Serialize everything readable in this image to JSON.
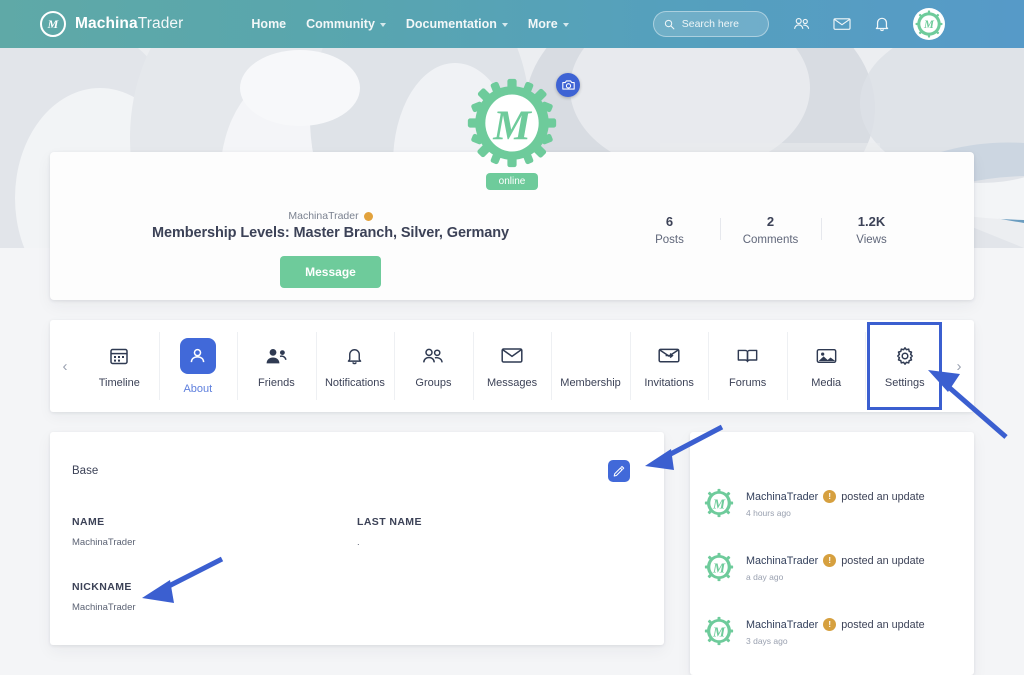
{
  "header": {
    "brand_bold": "Machina",
    "brand_light": "Trader",
    "brand_logo_letter": "M",
    "nav": [
      {
        "label": "Home",
        "has_caret": false
      },
      {
        "label": "Community",
        "has_caret": true
      },
      {
        "label": "Documentation",
        "has_caret": true
      },
      {
        "label": "More",
        "has_caret": true
      }
    ],
    "search": {
      "placeholder": "Search here"
    },
    "icons": [
      "friends-icon",
      "messages-icon",
      "notifications-icon",
      "account-avatar"
    ],
    "colors": {
      "gradient_left": "#5fa9a7",
      "gradient_right": "#569ac8"
    }
  },
  "profile": {
    "avatar_letter": "M",
    "camera_button": "camera-icon",
    "online_label": "online",
    "username": "MachinaTrader",
    "membership": "Membership Levels: Master Branch, Silver, Germany",
    "message_button": "Message",
    "stats": [
      {
        "value": "6",
        "label": "Posts"
      },
      {
        "value": "2",
        "label": "Comments"
      },
      {
        "value": "1.2K",
        "label": "Views"
      }
    ],
    "colors": {
      "green": "#6ecb9b",
      "badge_orange": "#e2a23c"
    }
  },
  "tabbar": {
    "prev_arrow": "‹",
    "next_arrow": "›",
    "tabs": [
      {
        "label": "Timeline",
        "icon": "calendar-icon",
        "active": false,
        "highlighted": false
      },
      {
        "label": "About",
        "icon": "person-icon",
        "active": true,
        "highlighted": false
      },
      {
        "label": "Friends",
        "icon": "friend-add-icon",
        "active": false,
        "highlighted": false
      },
      {
        "label": "Notifications",
        "icon": "bell-icon",
        "active": false,
        "highlighted": false
      },
      {
        "label": "Groups",
        "icon": "group-icon",
        "active": false,
        "highlighted": false
      },
      {
        "label": "Messages",
        "icon": "envelope-icon",
        "active": false,
        "highlighted": false
      },
      {
        "label": "Membership",
        "icon": "membership-icon",
        "active": false,
        "highlighted": false
      },
      {
        "label": "Invitations",
        "icon": "invitation-icon",
        "active": false,
        "highlighted": false
      },
      {
        "label": "Forums",
        "icon": "book-icon",
        "active": false,
        "highlighted": false
      },
      {
        "label": "Media",
        "icon": "image-icon",
        "active": false,
        "highlighted": false
      },
      {
        "label": "Settings",
        "icon": "gear-icon",
        "active": false,
        "highlighted": true
      }
    ],
    "active_color": "#4169d9",
    "highlight_color": "#3b5fd0"
  },
  "about": {
    "section_title": "Base",
    "edit_button": "edit-pencil-icon",
    "fields": [
      {
        "label": "NAME",
        "value": "MachinaTrader"
      },
      {
        "label": "LAST NAME",
        "value": "."
      },
      {
        "label": "NICKNAME",
        "value": "MachinaTrader"
      }
    ]
  },
  "activity": {
    "items": [
      {
        "user": "MachinaTrader",
        "badge": "!",
        "action": "posted an update",
        "time": "4 hours ago"
      },
      {
        "user": "MachinaTrader",
        "badge": "!",
        "action": "posted an update",
        "time": "a day ago"
      },
      {
        "user": "MachinaTrader",
        "badge": "!",
        "action": "posted an update",
        "time": "3 days ago"
      }
    ]
  },
  "annotations": {
    "arrow_color": "#3b5fd0",
    "arrows": [
      {
        "name": "arrow-to-settings-tab",
        "points_to": "Settings"
      },
      {
        "name": "arrow-to-edit-button",
        "points_to": "edit-pencil-icon"
      },
      {
        "name": "arrow-to-nickname-field",
        "points_to": "NICKNAME"
      }
    ]
  }
}
